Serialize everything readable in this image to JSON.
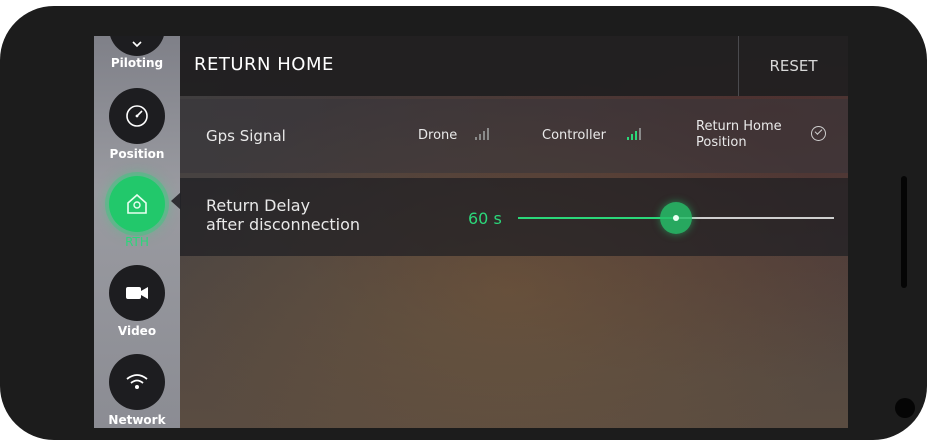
{
  "sidebar": {
    "items": [
      {
        "label": "Piloting",
        "icon": "chevron-down-icon"
      },
      {
        "label": "Position",
        "icon": "gauge-icon"
      },
      {
        "label": "RTH",
        "icon": "home-icon",
        "active": true
      },
      {
        "label": "Video",
        "icon": "camera-icon"
      },
      {
        "label": "Network",
        "icon": "wifi-icon"
      }
    ]
  },
  "header": {
    "title": "RETURN HOME",
    "reset_label": "RESET"
  },
  "gps": {
    "label": "Gps Signal",
    "drone_label": "Drone",
    "controller_label": "Controller",
    "return_home_position_label": "Return Home\nPosition"
  },
  "return_delay": {
    "label": "Return Delay\nafter disconnection",
    "value_text": "60 s",
    "slider_fraction": 0.5
  },
  "colors": {
    "accent": "#2bd77a",
    "signal_inactive": "#8a8a8a"
  }
}
